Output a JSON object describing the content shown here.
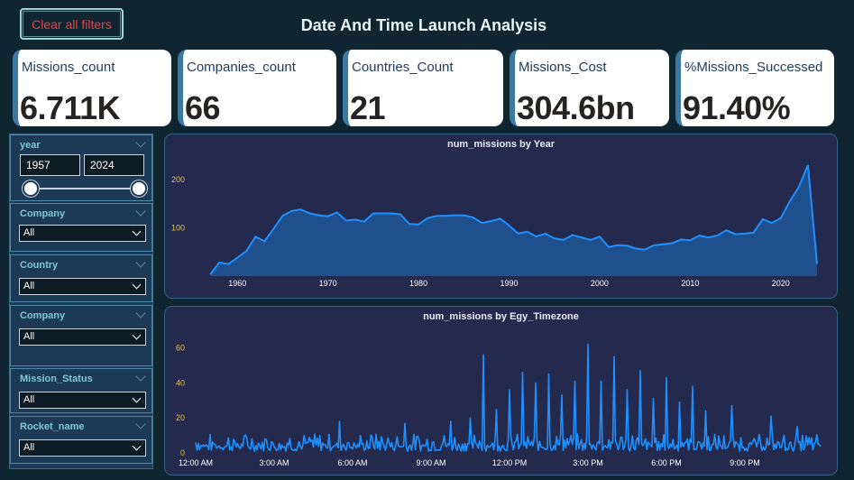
{
  "header": {
    "clear_filters_label": "Clear all filters",
    "title": "Date And Time Launch Analysis"
  },
  "kpis": [
    {
      "label": "Missions_count",
      "value": "6.711K"
    },
    {
      "label": "Companies_count",
      "value": "66"
    },
    {
      "label": "Countries_Count",
      "value": "21"
    },
    {
      "label": "Missions_Cost",
      "value": "304.6bn"
    },
    {
      "label": "%Missions_Successed",
      "value": "91.40%"
    }
  ],
  "filters": {
    "year": {
      "label": "year",
      "start": "1957",
      "end": "2024"
    },
    "company1": {
      "label": "Company",
      "value": "All"
    },
    "country": {
      "label": "Country",
      "value": "All"
    },
    "company2": {
      "label": "Company",
      "value": "All"
    },
    "mission_status": {
      "label": "Mission_Status",
      "value": "All"
    },
    "rocket_name": {
      "label": "Rocket_name",
      "value": "All"
    }
  },
  "colors": {
    "accent_line": "#1e90ff",
    "area_fill": "#1f4f8c",
    "kpi_border": "#3b79a3",
    "clear_text": "#e0454a",
    "y_tick": "#e6c44a"
  },
  "chart_data": [
    {
      "type": "area",
      "title": "num_missions by Year",
      "xlim": [
        1955,
        2025
      ],
      "ylim": [
        0,
        245
      ],
      "x_ticks": [
        "1960",
        "1970",
        "1980",
        "1990",
        "2000",
        "2010",
        "2020"
      ],
      "y_ticks": [
        "100",
        "200"
      ],
      "x": [
        1957,
        1958,
        1959,
        1960,
        1961,
        1962,
        1963,
        1964,
        1965,
        1966,
        1967,
        1968,
        1969,
        1970,
        1971,
        1972,
        1973,
        1974,
        1975,
        1976,
        1977,
        1978,
        1979,
        1980,
        1981,
        1982,
        1983,
        1984,
        1985,
        1986,
        1987,
        1988,
        1989,
        1990,
        1991,
        1992,
        1993,
        1994,
        1995,
        1996,
        1997,
        1998,
        1999,
        2000,
        2001,
        2002,
        2003,
        2004,
        2005,
        2006,
        2007,
        2008,
        2009,
        2010,
        2011,
        2012,
        2013,
        2014,
        2015,
        2016,
        2017,
        2018,
        2019,
        2020,
        2021,
        2022,
        2023,
        2024
      ],
      "values": [
        3,
        28,
        25,
        38,
        52,
        82,
        72,
        98,
        125,
        135,
        138,
        130,
        126,
        124,
        132,
        115,
        117,
        113,
        130,
        130,
        130,
        128,
        108,
        107,
        120,
        125,
        125,
        126,
        126,
        122,
        110,
        114,
        119,
        105,
        88,
        92,
        82,
        88,
        78,
        75,
        85,
        80,
        75,
        82,
        60,
        64,
        63,
        57,
        55,
        64,
        66,
        68,
        76,
        74,
        84,
        80,
        84,
        95,
        87,
        88,
        90,
        118,
        110,
        120,
        155,
        185,
        230,
        25
      ],
      "grid": false
    },
    {
      "type": "line",
      "title": "num_missions by Egy_Timezone",
      "xlim": [
        "12:00 AM",
        "11:59 PM"
      ],
      "ylim": [
        0,
        68
      ],
      "x_ticks": [
        "12:00 AM",
        "3:00 AM",
        "6:00 AM",
        "9:00 AM",
        "12:00 PM",
        "3:00 PM",
        "6:00 PM",
        "9:00 PM"
      ],
      "y_ticks": [
        "0",
        "20",
        "40",
        "60"
      ],
      "baseline_range": [
        1,
        11
      ],
      "spikes": [
        {
          "x": "5:30 AM",
          "y": 18
        },
        {
          "x": "8:00 AM",
          "y": 17
        },
        {
          "x": "9:45 AM",
          "y": 18
        },
        {
          "x": "10:30 AM",
          "y": 20
        },
        {
          "x": "11:00 AM",
          "y": 56
        },
        {
          "x": "11:30 AM",
          "y": 25
        },
        {
          "x": "12:00 PM",
          "y": 36
        },
        {
          "x": "12:30 PM",
          "y": 46
        },
        {
          "x": "1:00 PM",
          "y": 40
        },
        {
          "x": "1:30 PM",
          "y": 45
        },
        {
          "x": "2:00 PM",
          "y": 33
        },
        {
          "x": "2:30 PM",
          "y": 41
        },
        {
          "x": "3:00 PM",
          "y": 62
        },
        {
          "x": "3:30 PM",
          "y": 41
        },
        {
          "x": "4:00 PM",
          "y": 55
        },
        {
          "x": "4:30 PM",
          "y": 36
        },
        {
          "x": "5:00 PM",
          "y": 47
        },
        {
          "x": "5:30 PM",
          "y": 31
        },
        {
          "x": "6:00 PM",
          "y": 43
        },
        {
          "x": "6:30 PM",
          "y": 29
        },
        {
          "x": "7:00 PM",
          "y": 38
        },
        {
          "x": "7:30 PM",
          "y": 24
        },
        {
          "x": "8:30 PM",
          "y": 27
        },
        {
          "x": "10:00 PM",
          "y": 21
        },
        {
          "x": "11:00 PM",
          "y": 15
        }
      ],
      "grid": false
    }
  ]
}
